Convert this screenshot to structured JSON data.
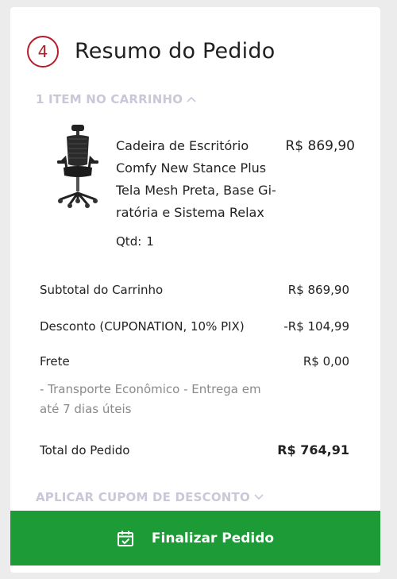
{
  "summary": {
    "step_number": "4",
    "title": "Resumo do Pedido",
    "cart_toggle_label": "1 ITEM NO CARRINHO"
  },
  "product": {
    "name": "Cadeira de Escritório Comfy New Stance Plus Tela Mesh Preta, Base Gi-ratória e Sistema Relax",
    "name_lines": [
      "Cadeira de Escritório",
      "Comfy New Stance Plus",
      "Tela Mesh Preta, Base Gi-",
      "ratória e Sistema Relax"
    ],
    "price": "R$ 869,90",
    "qty_label": "Qtd:",
    "qty_value": "1"
  },
  "totals": {
    "subtotal_label": "Subtotal do Carrinho",
    "subtotal_value": "R$ 869,90",
    "discount_label": "Desconto (CUPONATION, 10% PIX)",
    "discount_value": "-R$ 104,99",
    "shipping_label": "Frete",
    "shipping_value": "R$ 0,00",
    "shipping_desc_line1": "- Transporte Econômico - Entrega em",
    "shipping_desc_line2": "até 7 dias úteis",
    "total_label": "Total do Pedido",
    "total_value": "R$ 764,91"
  },
  "coupon": {
    "toggle_label": "APLICAR CUPOM DE DESCONTO"
  },
  "checkout": {
    "button_label": "Finalizar Pedido",
    "icon": "calendar-check-icon"
  },
  "colors": {
    "accent_red": "#b71c2a",
    "button_green": "#1d9b37",
    "muted_link": "#c8c8d8"
  }
}
